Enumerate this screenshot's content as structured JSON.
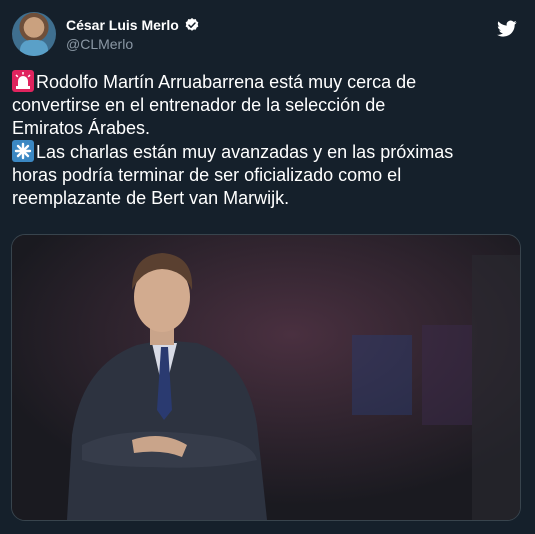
{
  "author": {
    "display_name": "César Luis Merlo",
    "handle": "@CLMerlo",
    "verified": true
  },
  "tweet": {
    "lines": [
      {
        "emoji": "siren-emoji",
        "text": "Rodolfo Martín Arruabarrena está muy cerca de"
      },
      {
        "emoji": "",
        "text": "convertirse en el entrenador de la selección de"
      },
      {
        "emoji": "",
        "text": "Emiratos Árabes."
      },
      {
        "emoji": "eight-spoked-asterisk-emoji",
        "text": "Las charlas están muy avanzadas y en las próximas"
      },
      {
        "emoji": "",
        "text": "horas podría terminar de ser oficializado como el"
      },
      {
        "emoji": "",
        "text": "reemplazante de Bert van Marwijk."
      }
    ]
  },
  "colors": {
    "background": "#15202b",
    "text": "#ffffff",
    "secondary_text": "#8b98a5",
    "verified": "#ffffff",
    "accent": "#1d9bf0"
  },
  "icons": [
    "verified-badge-icon",
    "twitter-logo-icon",
    "siren-emoji",
    "eight-spoked-asterisk-emoji"
  ]
}
